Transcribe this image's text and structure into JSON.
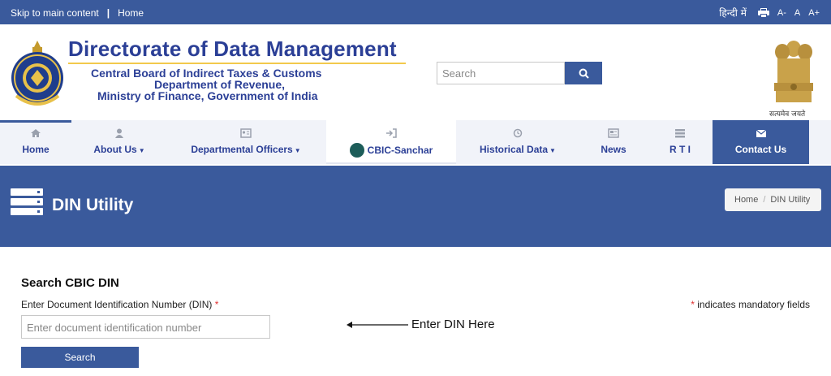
{
  "topbar": {
    "skip_link": "Skip to main content",
    "separator": "|",
    "home_link": "Home",
    "hindi_link": "हिन्दी में",
    "font_small": "A-",
    "font_normal": "A",
    "font_large": "A+"
  },
  "header": {
    "title": "Directorate of Data Management",
    "sub1": "Central Board of Indirect Taxes & Customs",
    "sub2": "Department of Revenue,",
    "sub3": "Ministry of Finance, Government of India",
    "search_placeholder": "Search",
    "emblem_caption": "सत्यमेव जयते"
  },
  "nav": {
    "items": [
      {
        "label": "Home",
        "icon": "home-icon"
      },
      {
        "label": "About Us",
        "icon": "user-icon",
        "dropdown": true
      },
      {
        "label": "Departmental Officers",
        "icon": "id-card-icon",
        "dropdown": true
      },
      {
        "label": "CBIC-Sanchar",
        "icon": "sanchar-logo"
      },
      {
        "label": "Historical Data",
        "icon": "history-icon",
        "dropdown": true
      },
      {
        "label": "News",
        "icon": "newspaper-icon"
      },
      {
        "label": "R T I",
        "icon": "list-icon"
      },
      {
        "label": "Contact Us",
        "icon": "envelope-icon"
      }
    ]
  },
  "banner": {
    "title": "DIN Utility",
    "breadcrumb_home": "Home",
    "breadcrumb_sep": "/",
    "breadcrumb_current": "DIN Utility"
  },
  "form": {
    "heading": "Search CBIC DIN",
    "label": "Enter Document Identification Number (DIN)",
    "required_mark": "*",
    "mandatory_note": "indicates mandatory fields",
    "input_placeholder": "Enter document identification number",
    "hint": "Enter DIN Here",
    "submit_label": "Search"
  },
  "colors": {
    "primary": "#3a5a9c",
    "title": "#2b3f96",
    "accent_underline": "#f2c94c",
    "required": "#e03131"
  }
}
